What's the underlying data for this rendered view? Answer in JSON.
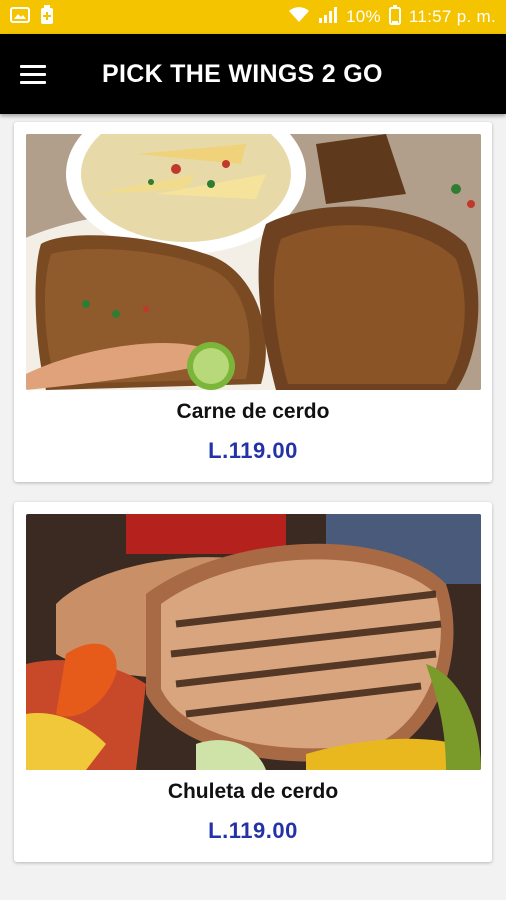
{
  "status_bar": {
    "signal_text": "10%",
    "time": "11:57 p. m.",
    "icons": [
      "image-icon",
      "battery-saver-icon",
      "wifi-icon",
      "signal-icon",
      "battery-icon"
    ],
    "bg_color": "#f5c400"
  },
  "app_bar": {
    "title": "PICK THE WINGS 2 GO",
    "menu_icon": "menu-icon",
    "bg_color": "#000000"
  },
  "products": [
    {
      "name": "Carne de cerdo",
      "price": "L.119.00",
      "image": "grilled pork chops with lime and fries"
    },
    {
      "name": "Chuleta de cerdo",
      "price": "L.119.00",
      "image": "grilled pork chop with peppers"
    }
  ],
  "colors": {
    "price": "#2432a8"
  }
}
